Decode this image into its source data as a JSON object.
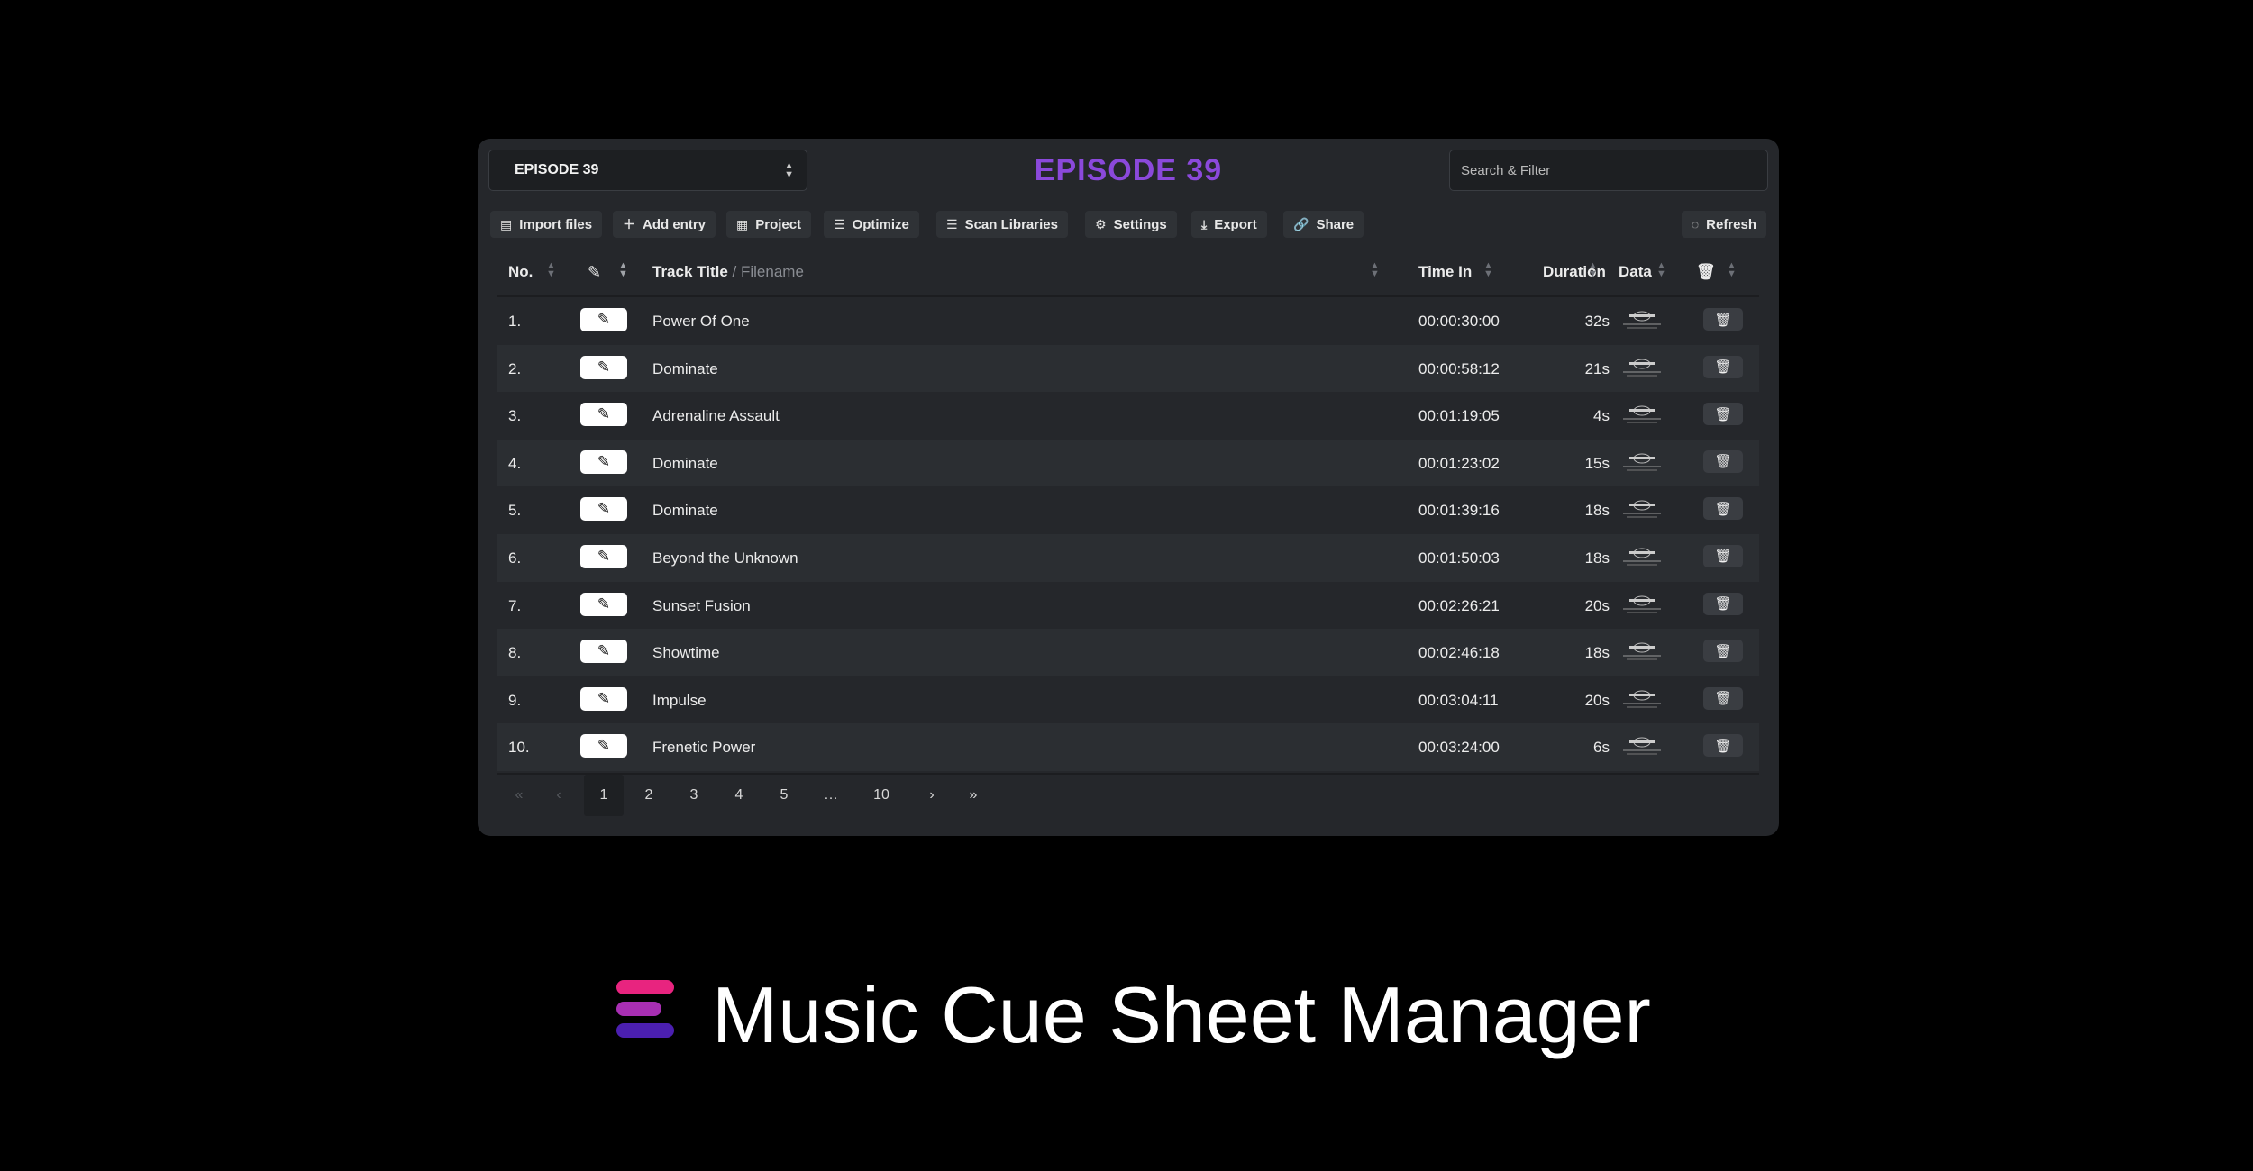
{
  "project_select": {
    "value": "EPISODE 39",
    "arrows": "▲▼"
  },
  "app_title": "EPISODE 39",
  "search": {
    "placeholder": "Search & Filter"
  },
  "toolbar": {
    "import": "Import files",
    "add": "Add entry",
    "project": "Project",
    "optimize": "Optimize",
    "scan": "Scan Libraries",
    "settings": "Settings",
    "export": "Export",
    "share": "Share",
    "refresh": "Refresh"
  },
  "table": {
    "headers": {
      "no": "No.",
      "track_title": "Track Title",
      "filename": "/ Filename",
      "time_in": "Time In",
      "duration": "Duration",
      "data": "Data"
    },
    "rows": [
      {
        "no": "1.",
        "title": "Power Of One",
        "time_in": "00:00:30:00",
        "duration": "32s"
      },
      {
        "no": "2.",
        "title": "Dominate",
        "time_in": "00:00:58:12",
        "duration": "21s"
      },
      {
        "no": "3.",
        "title": "Adrenaline Assault",
        "time_in": "00:01:19:05",
        "duration": "4s"
      },
      {
        "no": "4.",
        "title": "Dominate",
        "time_in": "00:01:23:02",
        "duration": "15s"
      },
      {
        "no": "5.",
        "title": "Dominate",
        "time_in": "00:01:39:16",
        "duration": "18s"
      },
      {
        "no": "6.",
        "title": "Beyond the Unknown",
        "time_in": "00:01:50:03",
        "duration": "18s"
      },
      {
        "no": "7.",
        "title": "Sunset Fusion",
        "time_in": "00:02:26:21",
        "duration": "20s"
      },
      {
        "no": "8.",
        "title": "Showtime",
        "time_in": "00:02:46:18",
        "duration": "18s"
      },
      {
        "no": "9.",
        "title": "Impulse",
        "time_in": "00:03:04:11",
        "duration": "20s"
      },
      {
        "no": "10.",
        "title": "Frenetic Power",
        "time_in": "00:03:24:00",
        "duration": "6s"
      }
    ]
  },
  "pagination": {
    "first": "«",
    "prev": "‹",
    "pages": [
      "1",
      "2",
      "3",
      "4",
      "5",
      "…",
      "10"
    ],
    "next": "›",
    "last": "»",
    "current": "1"
  },
  "brand": {
    "name": "Music Cue Sheet Manager",
    "colors": [
      "#e8247f",
      "#a82fb3",
      "#4b1fb0"
    ]
  },
  "colors": {
    "title_purple": "#8b49db",
    "panel": "#25272b",
    "background": "#000000"
  }
}
